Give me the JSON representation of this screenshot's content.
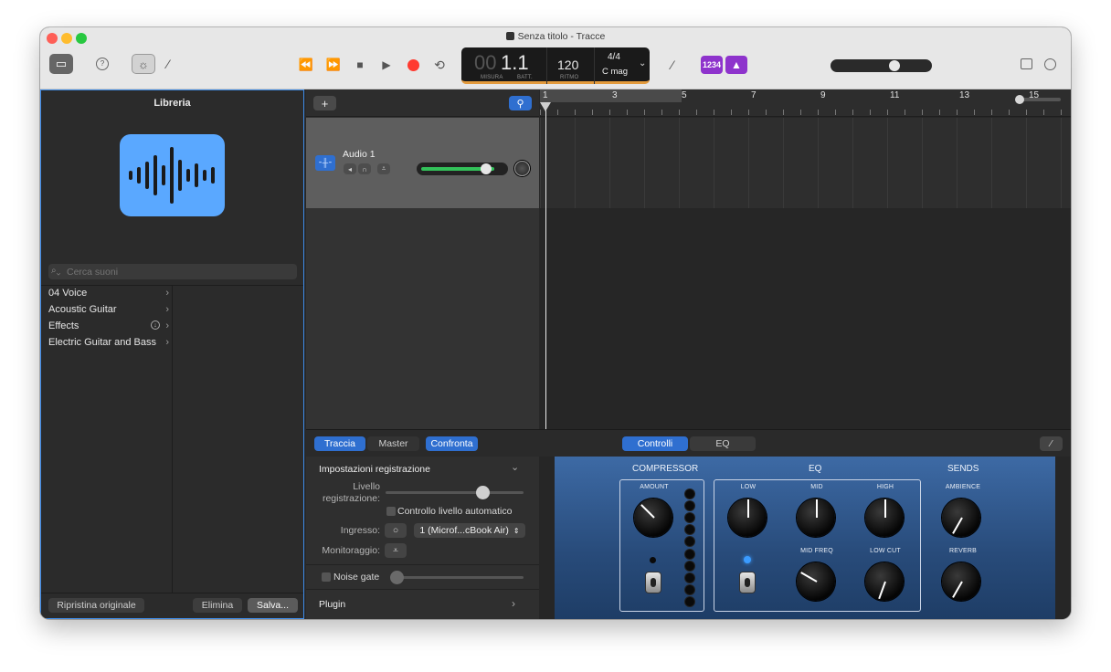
{
  "window": {
    "title": "Senza titolo - Tracce"
  },
  "toolbar": {
    "library_icon": "library-icon",
    "help_icon": "help-icon",
    "smart_controls_icon": "smart-controls-icon",
    "editors_icon": "scissors-icon",
    "transport": {
      "rewind": "⏪",
      "forward": "⏩",
      "stop": "■",
      "play": "▶",
      "record_color": "#ff3b30",
      "cycle": "⟲"
    },
    "lcd": {
      "position": "1.1",
      "position_dim": "00",
      "bar_label": "MISURA",
      "beat_label": "BATT.",
      "tempo": "120",
      "tempo_label": "RITMO",
      "signature": "4/4",
      "key": "C mag"
    },
    "tuner_icon": "tuner-icon",
    "count_in": "1234",
    "metronome_icon": "metronome-icon",
    "master_volume": 0.65,
    "notepad_icon": "notepad-icon",
    "loops_icon": "loops-icon"
  },
  "library": {
    "title": "Libreria",
    "patch_icon": "waveform-icon",
    "patch_color": "#5aa8ff",
    "search_placeholder": "Cerca suoni",
    "categories": [
      {
        "label": "04 Voice"
      },
      {
        "label": "Acoustic Guitar"
      },
      {
        "label": "Effects"
      },
      {
        "label": "Electric Guitar and Bass"
      }
    ],
    "revert_label": "Ripristina originale",
    "delete_label": "Elimina",
    "save_label": "Salva..."
  },
  "tracks": {
    "add_label": "+",
    "track": {
      "name": "Audio 1",
      "volume": 0.8
    },
    "ruler": [
      "1",
      "3",
      "5",
      "7",
      "9",
      "11",
      "13",
      "15"
    ]
  },
  "smart": {
    "tabs_left": [
      "Traccia",
      "Master",
      "Confronta"
    ],
    "tabs_right": [
      "Controlli",
      "EQ"
    ],
    "rec_settings_title": "Impostazioni registrazione",
    "rec_level_label_1": "Livello",
    "rec_level_label_2": "registrazione:",
    "auto_level_label": "Controllo livello automatico",
    "input_label": "Ingresso:",
    "input_value": "1 (Microf...cBook Air)",
    "monitoring_label": "Monitoraggio:",
    "noise_gate_label": "Noise gate",
    "plugin_label": "Plugin",
    "panel": {
      "compressor_title": "COMPRESSOR",
      "amount_label": "AMOUNT",
      "eq_title": "EQ",
      "low_label": "LOW",
      "mid_label": "MID",
      "high_label": "HIGH",
      "mid_freq_label": "MID FREQ",
      "low_cut_label": "LOW CUT",
      "sends_title": "SENDS",
      "ambience_label": "AMBIENCE",
      "reverb_label": "REVERB"
    }
  }
}
